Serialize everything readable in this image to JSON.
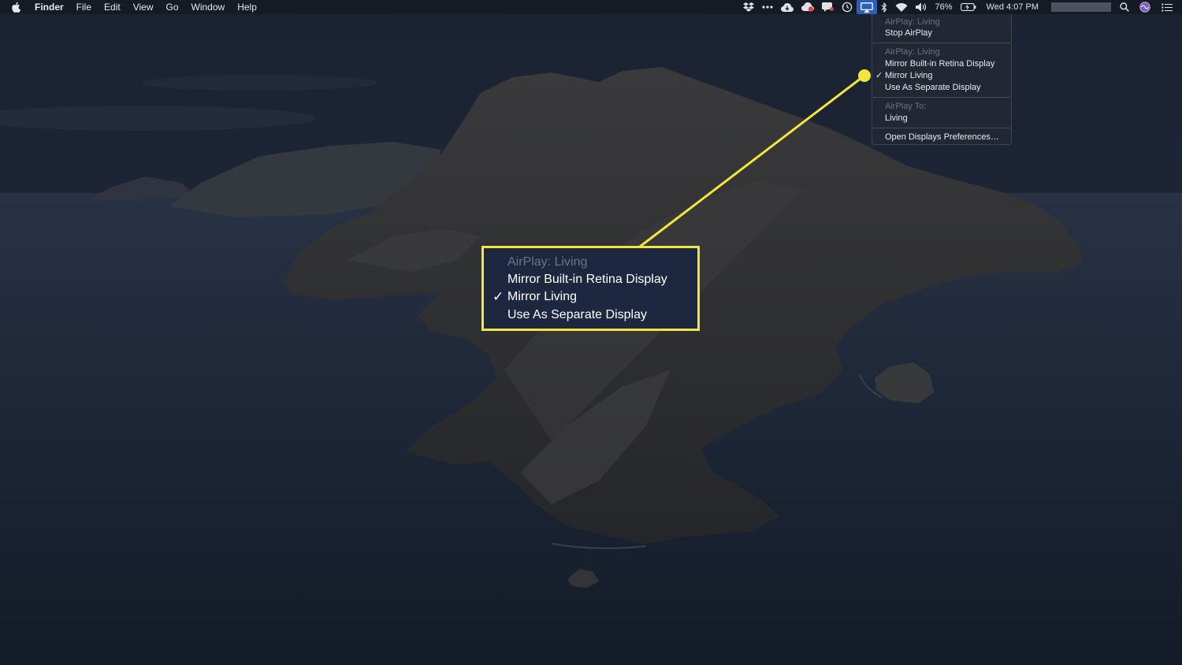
{
  "menubar": {
    "app_name": "Finder",
    "menus": [
      "File",
      "Edit",
      "View",
      "Go",
      "Window",
      "Help"
    ],
    "status_icons": [
      "dropbox-icon",
      "ellipsis-icon",
      "cloud-icon",
      "cloud-sync-icon",
      "notification-icon",
      "time-machine-icon",
      "airplay-icon",
      "bluetooth-icon",
      "wifi-icon",
      "volume-icon"
    ],
    "battery_percent": "76%",
    "clock": "Wed 4:07 PM",
    "right_icons": [
      "spotlight-icon",
      "siri-icon",
      "notification-center-icon"
    ]
  },
  "airplay_menu": {
    "section1_header": "AirPlay: Living",
    "stop_airplay": "Stop AirPlay",
    "section2_header": "AirPlay: Living",
    "mirror_builtin": "Mirror Built-in Retina Display",
    "mirror_living": "Mirror Living",
    "separate_display": "Use As Separate Display",
    "section3_header": "AirPlay To:",
    "living": "Living",
    "open_prefs": "Open Displays Preferences…",
    "checkmark": "✓"
  },
  "callout": {
    "header": "AirPlay: Living",
    "mirror_builtin": "Mirror Built-in Retina Display",
    "mirror_living": "Mirror Living",
    "separate_display": "Use As Separate Display",
    "checkmark": "✓"
  },
  "colors": {
    "highlight_yellow": "#f2e53b",
    "menu_bg": "#222834",
    "sea": "#1a2232",
    "rock": "#2e2f33"
  }
}
